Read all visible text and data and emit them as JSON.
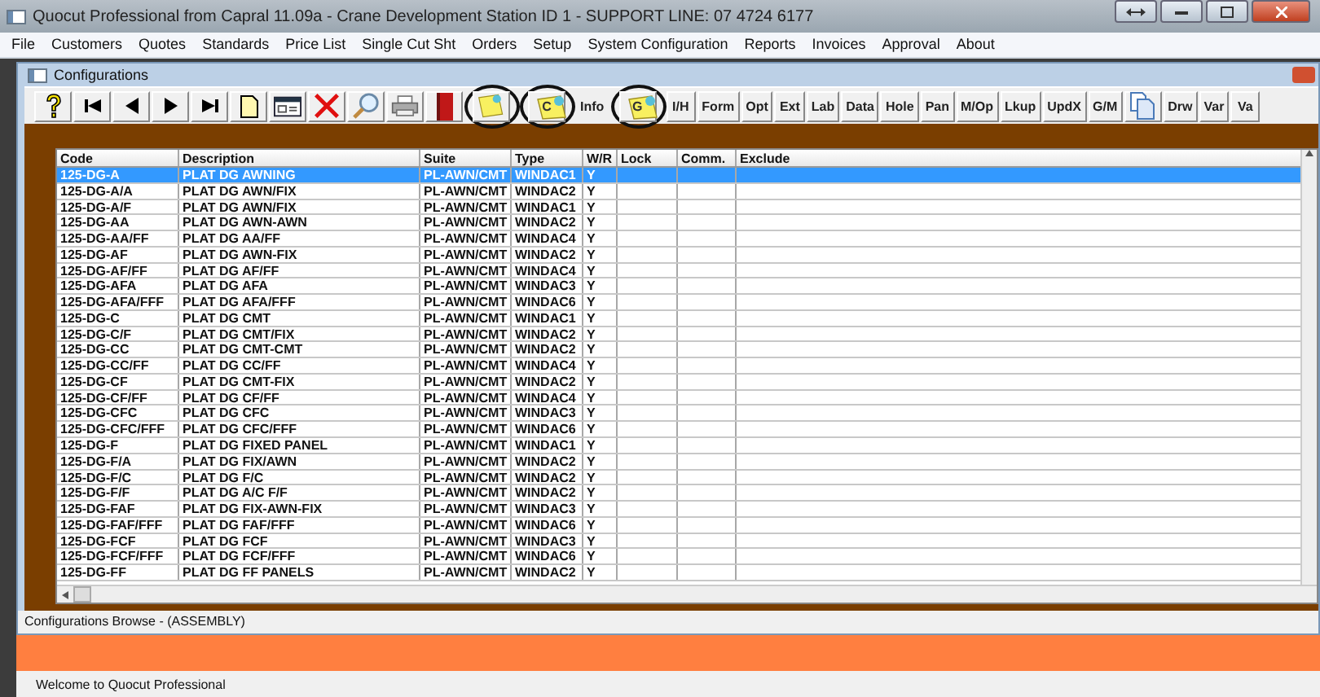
{
  "window": {
    "title": "Quocut Professional from Capral 11.09a - Crane Development Station ID 1 - SUPPORT LINE: 07 4724 6177"
  },
  "menu": [
    "File",
    "Customers",
    "Quotes",
    "Standards",
    "Price List",
    "Single Cut Sht",
    "Orders",
    "Setup",
    "System Configuration",
    "Reports",
    "Invoices",
    "Approval",
    "About"
  ],
  "child_window": {
    "title": "Configurations",
    "status": "Configurations Browse - (ASSEMBLY)"
  },
  "toolbar": [
    {
      "kind": "icon",
      "circled": false
    },
    {
      "kind": "icon",
      "circled": false
    },
    {
      "kind": "icon",
      "circled": false
    },
    {
      "kind": "icon",
      "circled": false
    },
    {
      "kind": "icon",
      "circled": false
    },
    {
      "kind": "icon",
      "circled": false
    },
    {
      "kind": "icon",
      "circled": false
    },
    {
      "kind": "icon",
      "circled": false
    },
    {
      "kind": "icon",
      "circled": false
    },
    {
      "kind": "icon",
      "circled": false
    },
    {
      "kind": "icon",
      "circled": false
    },
    {
      "kind": "icon",
      "circled": true
    },
    {
      "kind": "note",
      "label": "C",
      "circled": true
    },
    {
      "kind": "text",
      "label": "Info",
      "circled": false
    },
    {
      "kind": "note",
      "label": "G",
      "circled": true
    },
    {
      "kind": "text",
      "label": "I/H",
      "circled": false
    },
    {
      "kind": "text",
      "label": "Form",
      "circled": false
    },
    {
      "kind": "text",
      "label": "Opt",
      "circled": false
    },
    {
      "kind": "text",
      "label": "Ext",
      "circled": false
    },
    {
      "kind": "text",
      "label": "Lab",
      "circled": false
    },
    {
      "kind": "text",
      "label": "Data",
      "circled": false
    },
    {
      "kind": "text",
      "label": "Hole",
      "circled": false
    },
    {
      "kind": "text",
      "label": "Pan",
      "circled": false
    },
    {
      "kind": "text",
      "label": "M/Op",
      "circled": false
    },
    {
      "kind": "text",
      "label": "Lkup",
      "circled": false
    },
    {
      "kind": "text",
      "label": "UpdX",
      "circled": false
    },
    {
      "kind": "text",
      "label": "G/M",
      "circled": false
    },
    {
      "kind": "icon",
      "circled": false
    },
    {
      "kind": "text",
      "label": "Drw",
      "circled": false
    },
    {
      "kind": "text",
      "label": "Var",
      "circled": false
    },
    {
      "kind": "text",
      "label": "Va",
      "circled": false
    }
  ],
  "table": {
    "columns": [
      "Code",
      "Description",
      "Suite",
      "Type",
      "W/R",
      "Lock",
      "Comm.",
      "Exclude"
    ],
    "rows": [
      {
        "cells": [
          "125-DG-A",
          "PLAT DG AWNING",
          "PL-AWN/CMT",
          "WINDAC1",
          "Y"
        ],
        "selected": true
      },
      {
        "cells": [
          "125-DG-A/A",
          "PLAT DG AWN/FIX",
          "PL-AWN/CMT",
          "WINDAC2",
          "Y"
        ],
        "selected": false
      },
      {
        "cells": [
          "125-DG-A/F",
          "PLAT DG AWN/FIX",
          "PL-AWN/CMT",
          "WINDAC1",
          "Y"
        ],
        "selected": false
      },
      {
        "cells": [
          "125-DG-AA",
          "PLAT DG AWN-AWN",
          "PL-AWN/CMT",
          "WINDAC2",
          "Y"
        ],
        "selected": false
      },
      {
        "cells": [
          "125-DG-AA/FF",
          "PLAT DG AA/FF",
          "PL-AWN/CMT",
          "WINDAC4",
          "Y"
        ],
        "selected": false
      },
      {
        "cells": [
          "125-DG-AF",
          "PLAT DG AWN-FIX",
          "PL-AWN/CMT",
          "WINDAC2",
          "Y"
        ],
        "selected": false
      },
      {
        "cells": [
          "125-DG-AF/FF",
          "PLAT DG AF/FF",
          "PL-AWN/CMT",
          "WINDAC4",
          "Y"
        ],
        "selected": false
      },
      {
        "cells": [
          "125-DG-AFA",
          "PLAT DG AFA",
          "PL-AWN/CMT",
          "WINDAC3",
          "Y"
        ],
        "selected": false
      },
      {
        "cells": [
          "125-DG-AFA/FFF",
          "PLAT DG AFA/FFF",
          "PL-AWN/CMT",
          "WINDAC6",
          "Y"
        ],
        "selected": false
      },
      {
        "cells": [
          "125-DG-C",
          "PLAT DG CMT",
          "PL-AWN/CMT",
          "WINDAC1",
          "Y"
        ],
        "selected": false
      },
      {
        "cells": [
          "125-DG-C/F",
          "PLAT DG CMT/FIX",
          "PL-AWN/CMT",
          "WINDAC2",
          "Y"
        ],
        "selected": false
      },
      {
        "cells": [
          "125-DG-CC",
          "PLAT DG CMT-CMT",
          "PL-AWN/CMT",
          "WINDAC2",
          "Y"
        ],
        "selected": false
      },
      {
        "cells": [
          "125-DG-CC/FF",
          "PLAT DG CC/FF",
          "PL-AWN/CMT",
          "WINDAC4",
          "Y"
        ],
        "selected": false
      },
      {
        "cells": [
          "125-DG-CF",
          "PLAT DG CMT-FIX",
          "PL-AWN/CMT",
          "WINDAC2",
          "Y"
        ],
        "selected": false
      },
      {
        "cells": [
          "125-DG-CF/FF",
          "PLAT DG CF/FF",
          "PL-AWN/CMT",
          "WINDAC4",
          "Y"
        ],
        "selected": false
      },
      {
        "cells": [
          "125-DG-CFC",
          "PLAT DG CFC",
          "PL-AWN/CMT",
          "WINDAC3",
          "Y"
        ],
        "selected": false
      },
      {
        "cells": [
          "125-DG-CFC/FFF",
          "PLAT DG CFC/FFF",
          "PL-AWN/CMT",
          "WINDAC6",
          "Y"
        ],
        "selected": false
      },
      {
        "cells": [
          "125-DG-F",
          "PLAT DG FIXED PANEL",
          "PL-AWN/CMT",
          "WINDAC1",
          "Y"
        ],
        "selected": false
      },
      {
        "cells": [
          "125-DG-F/A",
          "PLAT DG FIX/AWN",
          "PL-AWN/CMT",
          "WINDAC2",
          "Y"
        ],
        "selected": false
      },
      {
        "cells": [
          "125-DG-F/C",
          "PLAT DG F/C",
          "PL-AWN/CMT",
          "WINDAC2",
          "Y"
        ],
        "selected": false
      },
      {
        "cells": [
          "125-DG-F/F",
          "PLAT DG A/C F/F",
          "PL-AWN/CMT",
          "WINDAC2",
          "Y"
        ],
        "selected": false
      },
      {
        "cells": [
          "125-DG-FAF",
          "PLAT DG FIX-AWN-FIX",
          "PL-AWN/CMT",
          "WINDAC3",
          "Y"
        ],
        "selected": false
      },
      {
        "cells": [
          "125-DG-FAF/FFF",
          "PLAT DG FAF/FFF",
          "PL-AWN/CMT",
          "WINDAC6",
          "Y"
        ],
        "selected": false
      },
      {
        "cells": [
          "125-DG-FCF",
          "PLAT DG FCF",
          "PL-AWN/CMT",
          "WINDAC3",
          "Y"
        ],
        "selected": false
      },
      {
        "cells": [
          "125-DG-FCF/FFF",
          "PLAT DG FCF/FFF",
          "PL-AWN/CMT",
          "WINDAC6",
          "Y"
        ],
        "selected": false
      },
      {
        "cells": [
          "125-DG-FF",
          "PLAT DG FF PANELS",
          "PL-AWN/CMT",
          "WINDAC2",
          "Y"
        ],
        "selected": false
      }
    ]
  },
  "status_bar": "Welcome to Quocut Professional"
}
